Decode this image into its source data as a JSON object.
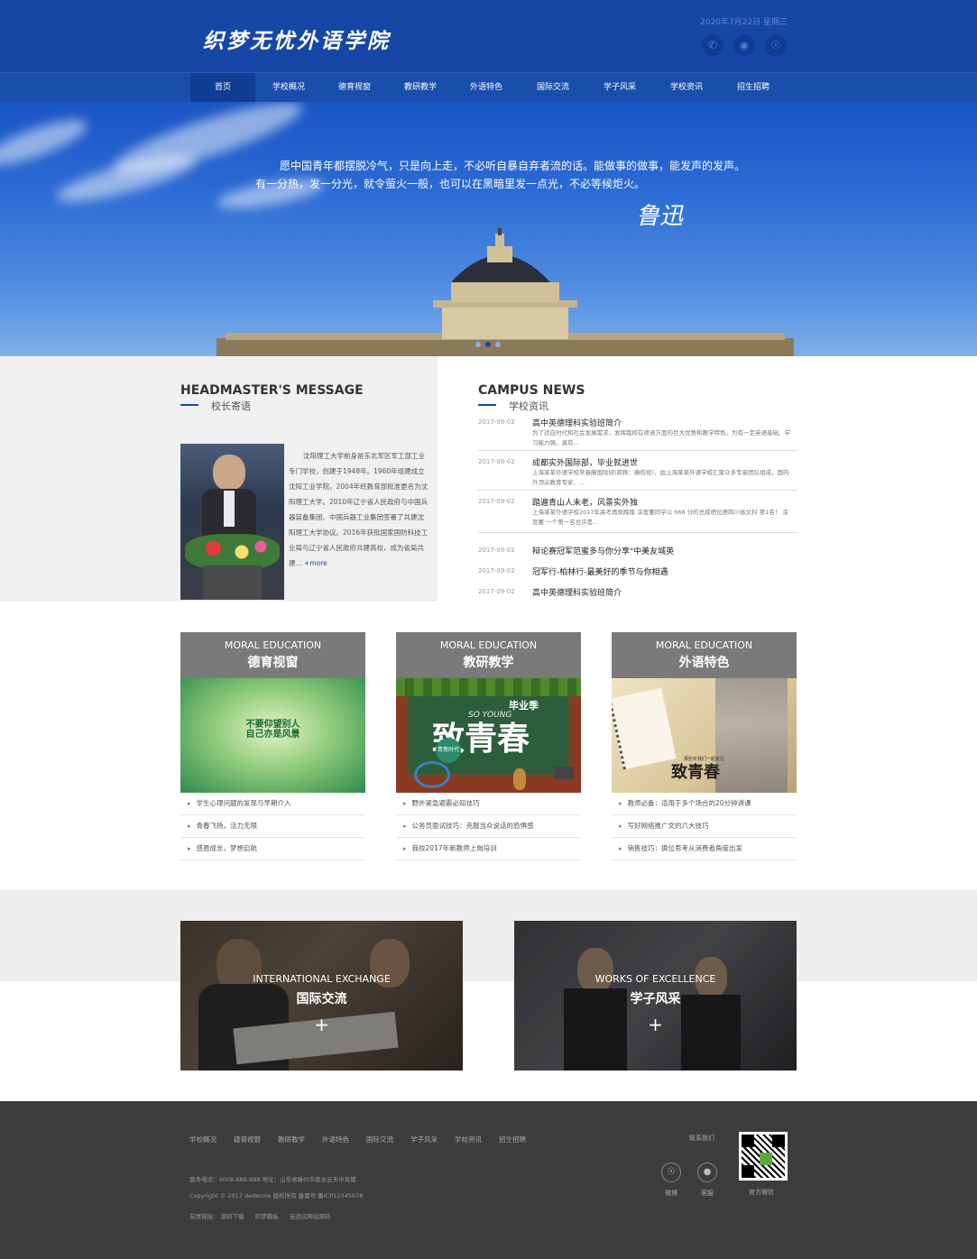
{
  "header": {
    "logo": "织梦无忧外语学院",
    "date": "2020年7月22日   星期三",
    "icons": [
      "phone-icon",
      "wechat-icon",
      "weibo-icon"
    ]
  },
  "nav": [
    "首页",
    "学校概况",
    "德育视窗",
    "教研教学",
    "外语特色",
    "国际交流",
    "学子风采",
    "学校资讯",
    "招生招聘"
  ],
  "banner": {
    "quote_line1": "愿中国青年都摆脱冷气，只是向上走，不必听自暴自弃者流的话。能做事的做事，能发声的发声。",
    "quote_line2": "有一分热，发一分光，就令萤火一般，也可以在黑暗里发一点光，不必等候炬火。",
    "signature": "鲁迅"
  },
  "headmaster": {
    "title": "HEADMASTER'S MESSAGE",
    "subtitle": "校长寄语",
    "text": "沈阳理工大学前身是东北军区军工部工业专门学校，创建于1948年。1960年组建成立沈阳工业学院，2004年经教育部批准更名为沈阳理工大学。2010年辽宁省人民政府与中国兵器装备集团、中国兵器工业集团签署了共建沈阳理工大学协议。2016年获批国家国防科技工业局与辽宁省人民政府共建高校，成为省局共建...",
    "more": "+more"
  },
  "campus_news": {
    "title": "CAMPUS NEWS",
    "subtitle": "学校资讯",
    "featured": [
      {
        "date": "2017-09-02",
        "title": "高中英德理科实验班简介",
        "desc": "为了适应时代和社会发展需求，发挥我校在德语方面的巨大优势和教学特色，为有一定英语基础、学习能力强、具有..."
      },
      {
        "date": "2017-09-02",
        "title": "成都实外国际部，毕业就进世",
        "desc": "上海某某外语学校常春藤国际班(简称：藤校班)，由上海某某外语学校汇聚众多专家团队组成，国内外顶尖教育专家、..."
      },
      {
        "date": "2017-09-02",
        "title": "踏遍青山人未老，风景实外独",
        "desc": "上海某某外语学校2017年高考再现辉煌 涂宽董同学以 668 分的总成绩位居四川省文科 第1名！ 涂宽董 一个第一名也许是..."
      }
    ],
    "list": [
      {
        "date": "2017-09-02",
        "title": "辩论赛冠军范蜜多与你分享\"中美友城英"
      },
      {
        "date": "2017-09-02",
        "title": "冠军行-柏林行-最美好的季节与你相遇"
      },
      {
        "date": "2017-09-02",
        "title": "高中英德理科实验班简介"
      }
    ]
  },
  "cards": [
    {
      "en": "MORAL EDUCATION",
      "zh": "德育视窗",
      "img_text": "不要仰望别人\n自己亦是风景",
      "items": [
        "学生心理问题的发现与早期介入",
        "青春飞扬，活力无限",
        "感恩成长，梦想启航"
      ]
    },
    {
      "en": "MORAL EDUCATION",
      "zh": "教研教学",
      "img_text_big": "致青春",
      "img_text_small": "毕业季",
      "img_text_en": "SO YOUNG",
      "img_stamp": "青葱时代",
      "items": [
        "野外紧急避震必知技巧",
        "公务员面试技巧：克服当众说话的恐惧感",
        "我校2017年新教师上岗培训"
      ]
    },
    {
      "en": "MORAL EDUCATION",
      "zh": "外语特色",
      "img_text": "致青春",
      "img_text_small": "那些年我们一起走过",
      "items": [
        "教师必备：适用于多个场合的20分钟讲课",
        "写好网络推广文的六大技巧",
        "销售技巧：换位思考从消费者角度出发"
      ]
    }
  ],
  "photos": [
    {
      "en": "INTERNATIONAL EXCHANGE",
      "zh": "国际交流",
      "plus": "+"
    },
    {
      "en": "WORKS OF EXCELLENCE",
      "zh": "学子风采",
      "plus": "+"
    }
  ],
  "footer": {
    "links": [
      "学校概况",
      "德育视窗",
      "教研教学",
      "外语特色",
      "国际交流",
      "学子风采",
      "学校资讯",
      "招生招聘"
    ],
    "service": "服务电话：4008-888-888   地址：山东省滕州市善水云天中央城",
    "copyright": "Copyright © 2017 dedecms 版权所有   备案号:鲁ICP12345678",
    "friend_links_label": "友情链接：",
    "friend_links": [
      "源码下载",
      "织梦模板",
      "自适应网站源码"
    ],
    "contact": "联系我们",
    "icon_labels": [
      "微博",
      "客服"
    ],
    "qr_label": "官方微信"
  }
}
